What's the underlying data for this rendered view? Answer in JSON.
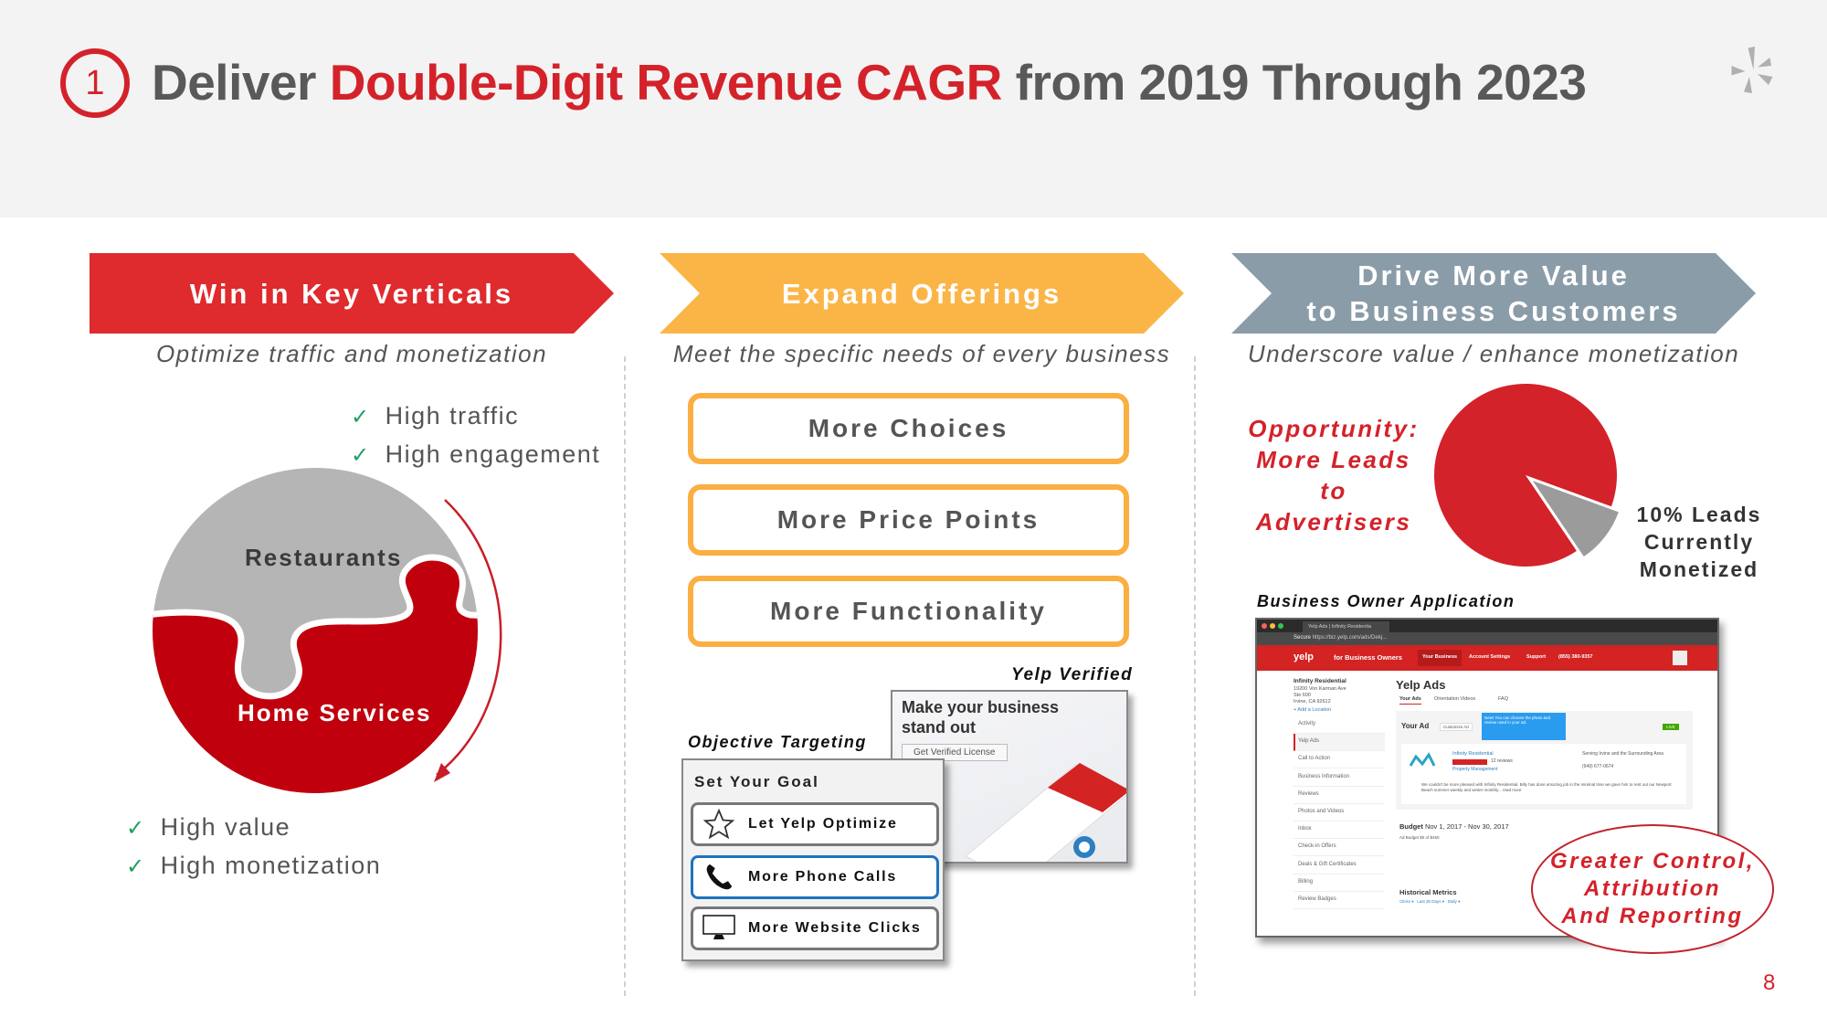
{
  "slide": {
    "number_badge": "1",
    "title_parts": {
      "prefix": "Deliver ",
      "highlight": "Double-Digit Revenue CAGR",
      "suffix": " from 2019 Through 2023"
    },
    "logo": "yelp-burst-logo",
    "page_number": "8"
  },
  "colors": {
    "red": "#d4222a",
    "orange": "#fbae42",
    "slate": "#8a9ca8",
    "gray_text": "#595959",
    "check_green": "#1fa060"
  },
  "columns": [
    {
      "header_lines": [
        "Win in Key Verticals"
      ],
      "subtitle": "Optimize traffic and monetization"
    },
    {
      "header_lines": [
        "Expand Offerings"
      ],
      "subtitle": "Meet the specific needs of every business"
    },
    {
      "header_lines": [
        "Drive More Value",
        "to Business Customers"
      ],
      "subtitle": "Underscore value / enhance monetization"
    }
  ],
  "verticals": {
    "top_checks": [
      "High traffic",
      "High engagement"
    ],
    "puzzle_top_label": "Restaurants",
    "puzzle_bottom_label": "Home Services",
    "bottom_checks": [
      "High value",
      "High monetization"
    ],
    "check_icon": "checkmark-icon"
  },
  "offerings": {
    "boxes": [
      "More Choices",
      "More Price Points",
      "More Functionality"
    ],
    "yelp_verified": {
      "caption": "Yelp Verified",
      "headline_lines": [
        "Make your business",
        "stand out"
      ],
      "button": "Get Verified License"
    },
    "objective_targeting": {
      "caption": "Objective Targeting",
      "panel_title": "Set Your Goal",
      "options": [
        {
          "label": "Let Yelp Optimize",
          "icon": "star-icon",
          "selected": false
        },
        {
          "label": "More Phone Calls",
          "icon": "phone-icon",
          "selected": true
        },
        {
          "label": "More Website Clicks",
          "icon": "monitor-icon",
          "selected": false
        }
      ]
    }
  },
  "value": {
    "opportunity_lines": [
      "Opportunity:",
      "More Leads",
      "to Advertisers"
    ],
    "pie_label_lines": [
      "10% Leads",
      "Currently",
      "Monetized"
    ],
    "app_caption": "Business Owner Application",
    "callout_lines": [
      "Greater Control,",
      "Attribution",
      "And Reporting"
    ],
    "browser": {
      "tab_title": "Yelp Ads | Infinity Residentia",
      "url_secure": "Secure",
      "url": "https://biz.yelp.com/ads/Dekj...",
      "brand": "yelp",
      "brand_suffix": "for Business Owners",
      "nav": [
        "Your Business",
        "Account Settings",
        "Support",
        "(855) 380-9357"
      ],
      "business_name": "Infinity Residential",
      "address_lines": [
        "19200 Von Karman Ave",
        "Ste 600",
        "Irvine, CA 92612"
      ],
      "add_location": "+ Add a Location",
      "sidebar": [
        "Activity",
        "Yelp Ads",
        "Call to Action",
        "Business Information",
        "Reviews",
        "Photos and Videos",
        "Inbox",
        "Check-in Offers",
        "Deals & Gift Certificates",
        "Billing",
        "Review Badges"
      ],
      "sidebar_active": "Yelp Ads",
      "page_title": "Yelp Ads",
      "tabs": [
        "Your Ads",
        "Orientation Videos",
        "FAQ"
      ],
      "your_ad": "Your Ad",
      "customize": "Customize Ad",
      "tooltip": "New! You can choose the photo and review used in your ad.",
      "live_badge": "LIVE",
      "ad_business": "Infinity Residential",
      "ad_reviews": "12 reviews",
      "ad_category": "Property Management",
      "ad_area": "Serving Irvine and the Surrounding Area",
      "ad_phone": "(949) 677-0674",
      "ad_review_text": "We couldn't be more pleased with Infinity Residential. Billy has done amazing job in the minimal time we gave him to rent out our Newport Beach summer weekly and winter monthly... read more",
      "budget_title": "Budget",
      "budget_range": "Nov 1, 2017 - Nov 30, 2017",
      "ad_budget": "Ad Budget $0 of $450",
      "metrics_title": "Historical Metrics",
      "metrics_filters": [
        "Clicks",
        "Last 30 Days",
        "Daily"
      ]
    }
  },
  "chart_data": {
    "type": "pie",
    "title": "",
    "slices": [
      {
        "label": "Opportunity: More Leads to Advertisers",
        "value": 90,
        "color": "#d4222a"
      },
      {
        "label": "10% Leads Currently Monetized",
        "value": 10,
        "color": "#9b9b9b",
        "exploded": true
      }
    ]
  }
}
